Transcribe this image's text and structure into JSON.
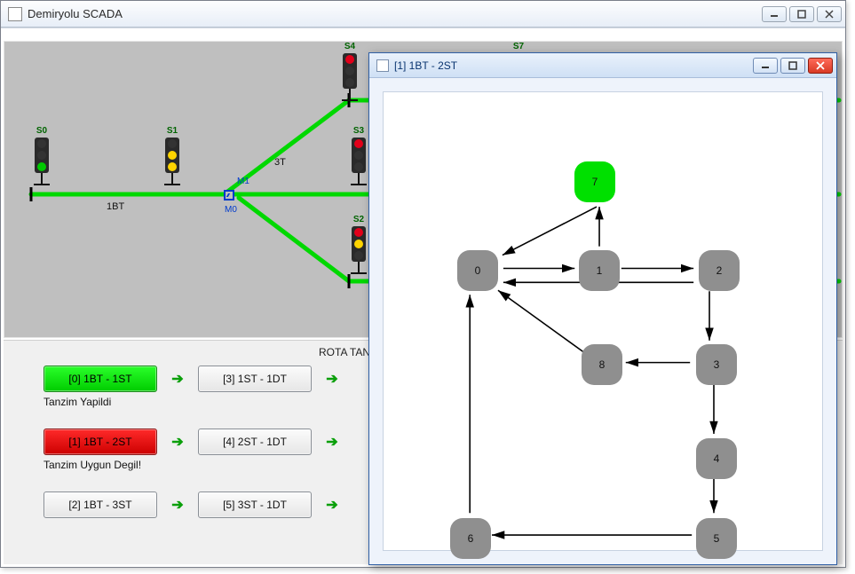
{
  "main_window": {
    "title": "Demiryolu SCADA"
  },
  "scada": {
    "signals": {
      "S0": "S0",
      "S1": "S1",
      "S2": "S2",
      "S3": "S3",
      "S4": "S4",
      "S7": "S7"
    },
    "track_labels": {
      "t1BT": "1BT",
      "t3T": "3T"
    },
    "switches": {
      "M0": "M0",
      "M1": "M1"
    }
  },
  "rota": {
    "heading": "ROTA TANZIM",
    "routes": {
      "r0": "[0]  1BT - 1ST",
      "r1": "[1]  1BT - 2ST",
      "r2": "[2]  1BT - 3ST",
      "r3": "[3]  1ST - 1DT",
      "r4": "[4]  2ST - 1DT",
      "r5": "[5]  3ST - 1DT"
    },
    "status": {
      "s1": "Tanzim Yapildi",
      "s2": "Tanzim Uygun Degil!"
    }
  },
  "graph": {
    "title": "[1]  1BT - 2ST",
    "nodes": {
      "n0": "0",
      "n1": "1",
      "n2": "2",
      "n3": "3",
      "n4": "4",
      "n5": "5",
      "n6": "6",
      "n7": "7",
      "n8": "8"
    }
  }
}
